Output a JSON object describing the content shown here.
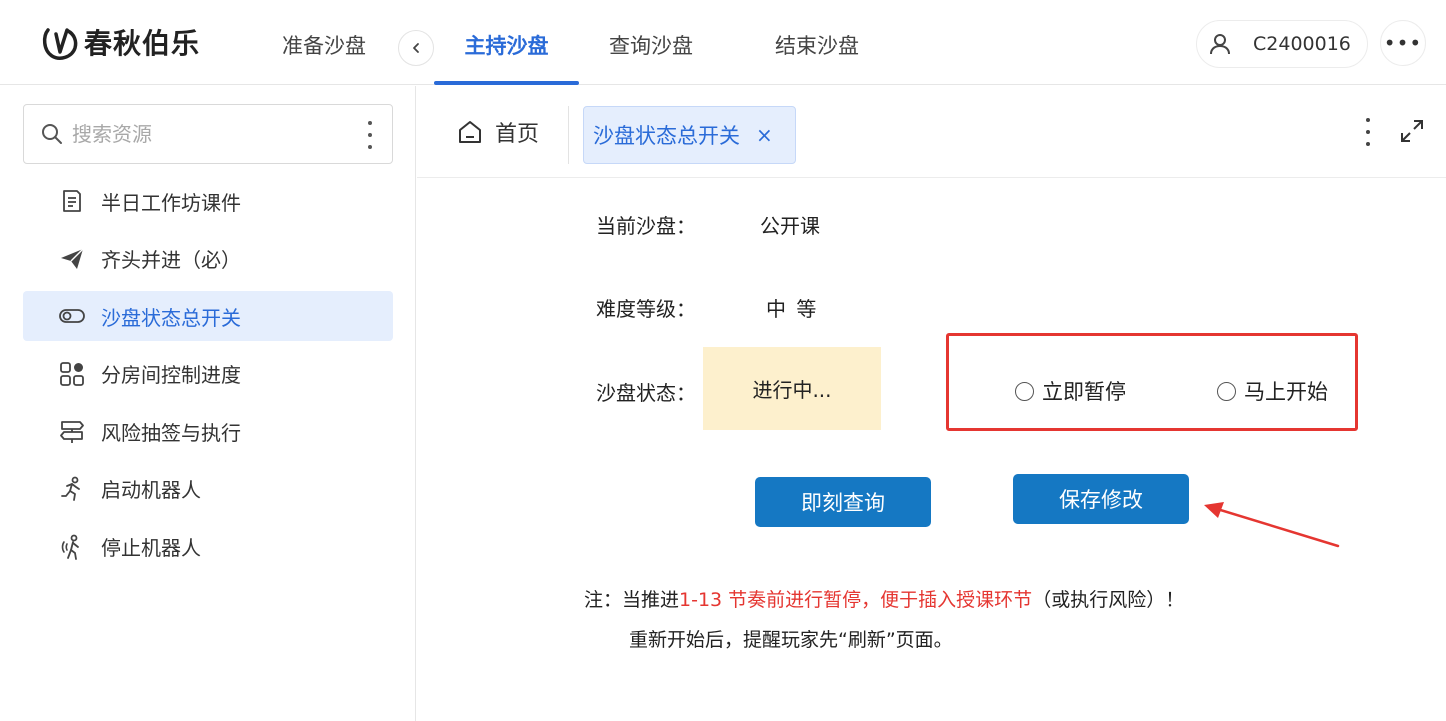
{
  "app": {
    "brand": "春秋伯乐",
    "nav": [
      "准备沙盘",
      "主持沙盘",
      "查询沙盘",
      "结束沙盘"
    ],
    "active_nav_index": 1,
    "user_id": "C2400016",
    "more_label": "•••"
  },
  "sidebar": {
    "search_placeholder": "搜索资源",
    "items": [
      {
        "label": "半日工作坊课件",
        "icon": "document-icon"
      },
      {
        "label": "齐头并进（必）",
        "icon": "paper-plane-icon"
      },
      {
        "label": "沙盘状态总开关",
        "icon": "toggle-icon"
      },
      {
        "label": "分房间控制进度",
        "icon": "grid-apps-icon"
      },
      {
        "label": "风险抽签与执行",
        "icon": "signpost-icon"
      },
      {
        "label": "启动机器人",
        "icon": "running-person-icon"
      },
      {
        "label": "停止机器人",
        "icon": "walking-person-icon"
      }
    ],
    "active_index": 2
  },
  "tabs": {
    "home": "首页",
    "active": "沙盘状态总开关",
    "close": "×"
  },
  "form": {
    "current_label": "当前沙盘：",
    "current_value": "公开课",
    "difficulty_label": "难度等级：",
    "difficulty_value": "中 等",
    "status_label": "沙盘状态：",
    "status_value": "进行中...",
    "radio_pause": "立即暂停",
    "radio_start": "马上开始",
    "query_button": "即刻查询",
    "save_button": "保存修改"
  },
  "note": {
    "prefix": "注：当推进",
    "red": "1-13 节奏前进行暂停，便于插入授课环节",
    "suffix": "（或执行风险）！",
    "line2": "重新开始后，提醒玩家先“刷新”页面。"
  },
  "colors": {
    "accent": "#2a6bd8",
    "button": "#1578c3",
    "highlight": "#e53631",
    "status_bg": "#fdf0cd"
  }
}
